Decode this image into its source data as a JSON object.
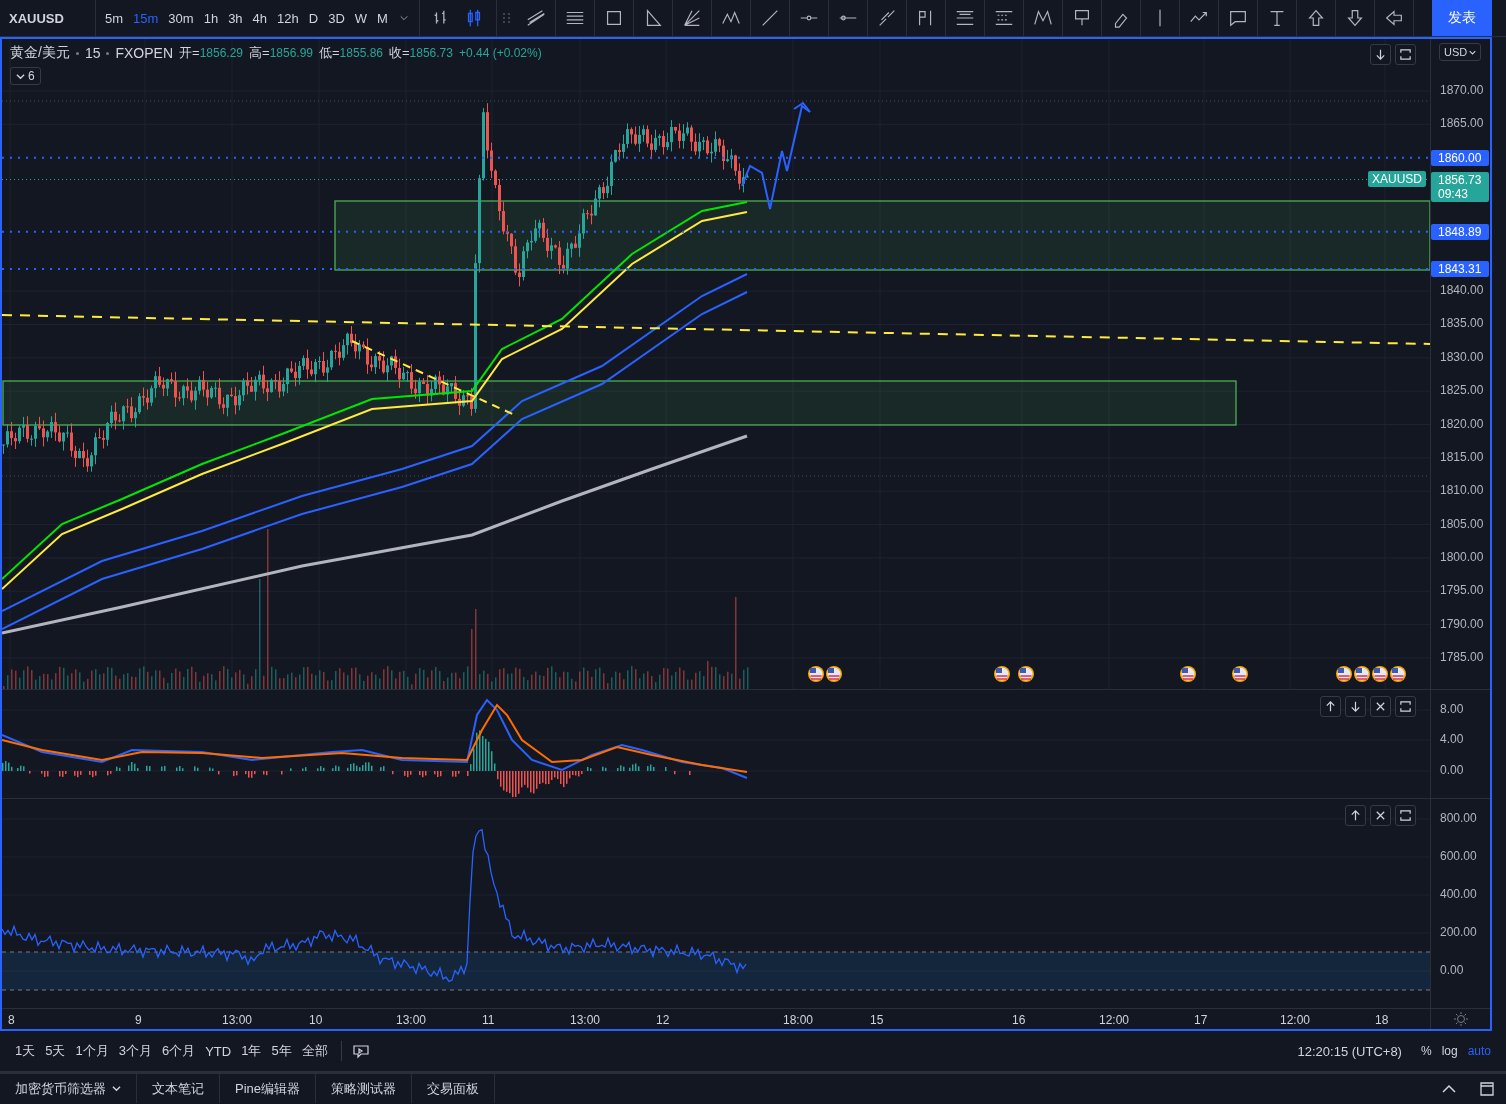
{
  "toolbar": {
    "symbol": "XAUUSD",
    "intervals": [
      {
        "label": "5m",
        "selected": false
      },
      {
        "label": "15m",
        "selected": true
      },
      {
        "label": "30m",
        "selected": false
      },
      {
        "label": "1h",
        "selected": false
      },
      {
        "label": "3h",
        "selected": false
      },
      {
        "label": "4h",
        "selected": false
      },
      {
        "label": "12h",
        "selected": false
      },
      {
        "label": "D",
        "selected": false
      },
      {
        "label": "3D",
        "selected": false
      },
      {
        "label": "W",
        "selected": false
      },
      {
        "label": "M",
        "selected": false
      }
    ],
    "chart_types": [
      {
        "kind": "bars",
        "selected": false
      },
      {
        "kind": "candles",
        "selected": true
      }
    ],
    "publish_button": "发表"
  },
  "legend": {
    "symbol_name": "黄金/美元",
    "interval": "15",
    "exchange": "FXOPEN",
    "ohlc": [
      {
        "label": "开=",
        "value": "1856.29"
      },
      {
        "label": "高=",
        "value": "1856.99"
      },
      {
        "label": "低=",
        "value": "1855.86"
      },
      {
        "label": "收=",
        "value": "1856.73"
      }
    ],
    "change": "+0.44 (+0.02%)",
    "indicators_toggle": "6"
  },
  "currency_button": "USD",
  "price_axis": {
    "labels": [
      "1870.00",
      "1865.00",
      "1840.00",
      "1835.00",
      "1830.00",
      "1825.00",
      "1820.00",
      "1815.00",
      "1810.00",
      "1805.00",
      "1800.00",
      "1795.00",
      "1790.00",
      "1785.00"
    ],
    "tags": [
      {
        "kind": "level",
        "value": "1860.00"
      },
      {
        "kind": "last",
        "symbol": "XAUUSD",
        "value": "1856.73",
        "countdown": "09:43"
      },
      {
        "kind": "level",
        "value": "1848.89"
      },
      {
        "kind": "level",
        "value": "1843.31"
      }
    ]
  },
  "macd_axis": [
    "8.00",
    "4.00",
    "0.00"
  ],
  "oscillator_axis": [
    "800.00",
    "600.00",
    "400.00",
    "200.00",
    "0.00"
  ],
  "time_axis": [
    "8",
    "9",
    "13:00",
    "10",
    "13:00",
    "11",
    "13:00",
    "12",
    "18:00",
    "15",
    "16",
    "12:00",
    "17",
    "12:00",
    "18"
  ],
  "ranges": [
    "1天",
    "5天",
    "1个月",
    "3个月",
    "6个月",
    "YTD",
    "1年",
    "5年",
    "全部"
  ],
  "clock": "12:20:15 (UTC+8)",
  "scale_options": [
    {
      "label": "%",
      "selected": false
    },
    {
      "label": "log",
      "selected": false
    },
    {
      "label": "auto",
      "selected": true
    }
  ],
  "bottom_tabs": [
    "加密货币筛选器",
    "文本笔记",
    "Pine编辑器",
    "策略测试器",
    "交易面板"
  ]
}
